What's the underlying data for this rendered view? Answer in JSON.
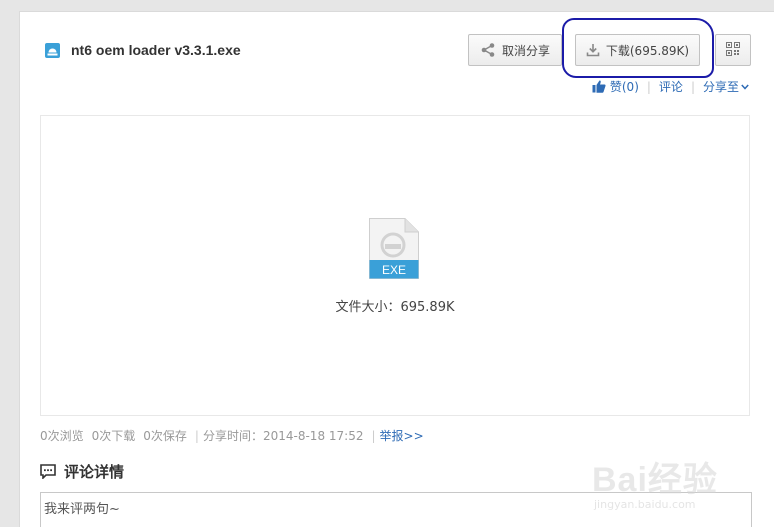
{
  "file": {
    "name": "nt6 oem loader v3.3.1.exe",
    "type_label": "EXE",
    "size_text": "文件大小：695.89K"
  },
  "toolbar": {
    "cancel_share_label": "取消分享",
    "download_label": "下载(695.89K)"
  },
  "actions": {
    "like_label": "赞(0)",
    "comment_label": "评论",
    "share_to_label": "分享至"
  },
  "stats": {
    "views": "0次浏览",
    "downloads": "0次下载",
    "saves": "0次保存",
    "share_time": "分享时间：2014-8-18 17:52",
    "report": "举报>>"
  },
  "comments": {
    "heading": "评论详情",
    "placeholder": "我来评两句~"
  },
  "watermark": {
    "brand": "Bai经验",
    "url": "jingyan.baidu.com"
  },
  "colors": {
    "accent": "#2e6bb5",
    "exe_band": "#3aa0d8",
    "annotation": "#1b1ba8"
  }
}
